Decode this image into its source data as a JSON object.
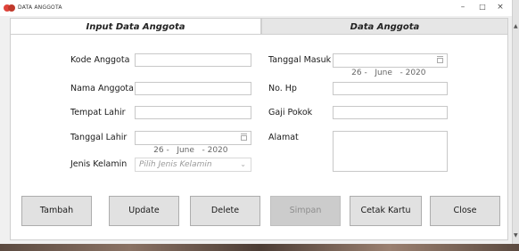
{
  "window": {
    "title": "DATA ANGGOTA",
    "minimize": "–",
    "maximize": "□",
    "close": "×"
  },
  "tabs": [
    {
      "label": "Input Data Anggota",
      "active": true
    },
    {
      "label": "Data Anggota",
      "active": false
    }
  ],
  "form": {
    "kode_anggota": {
      "label": "Kode Anggota",
      "value": ""
    },
    "nama_anggota": {
      "label": "Nama Anggota",
      "value": ""
    },
    "tempat_lahir": {
      "label": "Tempat Lahir",
      "value": ""
    },
    "tanggal_lahir": {
      "label": "Tanggal Lahir",
      "value": "26 -   June   - 2020"
    },
    "jenis_kelamin": {
      "label": "Jenis Kelamin",
      "placeholder": "Pilih Jenis Kelamin"
    },
    "tanggal_masuk": {
      "label": "Tanggal Masuk",
      "value": "26 -   June   - 2020"
    },
    "no_hp": {
      "label": "No. Hp",
      "value": ""
    },
    "gaji_pokok": {
      "label": "Gaji Pokok",
      "value": ""
    },
    "alamat": {
      "label": "Alamat",
      "value": ""
    }
  },
  "buttons": {
    "tambah": "Tambah",
    "update": "Update",
    "delete": "Delete",
    "simpan": {
      "label": "Simpan",
      "enabled": false
    },
    "cetak_kartu": "Cetak Kartu",
    "close": "Close"
  },
  "colors": {
    "window_bg": "#f0f0f0",
    "button_bg": "#e1e1e1",
    "disabled_text": "#8e8e8e"
  }
}
